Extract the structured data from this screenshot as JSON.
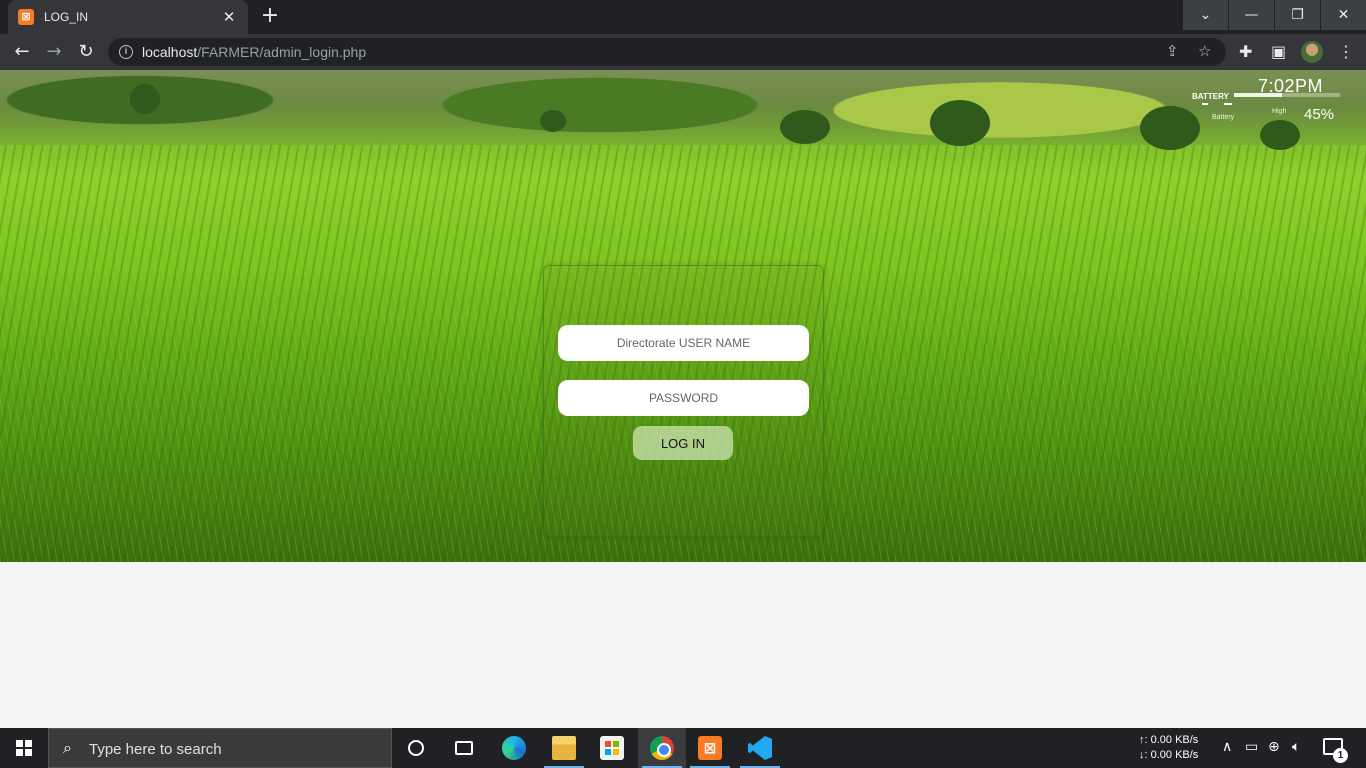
{
  "browser": {
    "tab_title": "LOG_IN",
    "tab_favicon": "xampp-icon",
    "url_host": "localhost",
    "url_path": "/FARMER/admin_login.php"
  },
  "widget": {
    "time": "7:02PM",
    "battery_label": "BATTERY",
    "battery_sub": "Battery",
    "status": "High",
    "battery_percent": "45%",
    "battery_level": 0.45
  },
  "login": {
    "username_placeholder": "Directorate USER NAME",
    "password_placeholder": "PASSWORD",
    "button_label": "LOG IN"
  },
  "taskbar": {
    "search_placeholder": "Type here to search",
    "net_up": "↑: 0.00 KB/s",
    "net_down": "↓: 0.00 KB/s",
    "notification_count": "1",
    "apps": [
      "cortana-icon",
      "task-view-icon",
      "edge-icon",
      "file-explorer-icon",
      "store-icon",
      "chrome-icon",
      "xampp-icon",
      "vscode-icon"
    ]
  },
  "colors": {
    "page_background": "#f4f4f4",
    "chrome_dark": "#202124",
    "accent_orange": "#fb7a24"
  }
}
